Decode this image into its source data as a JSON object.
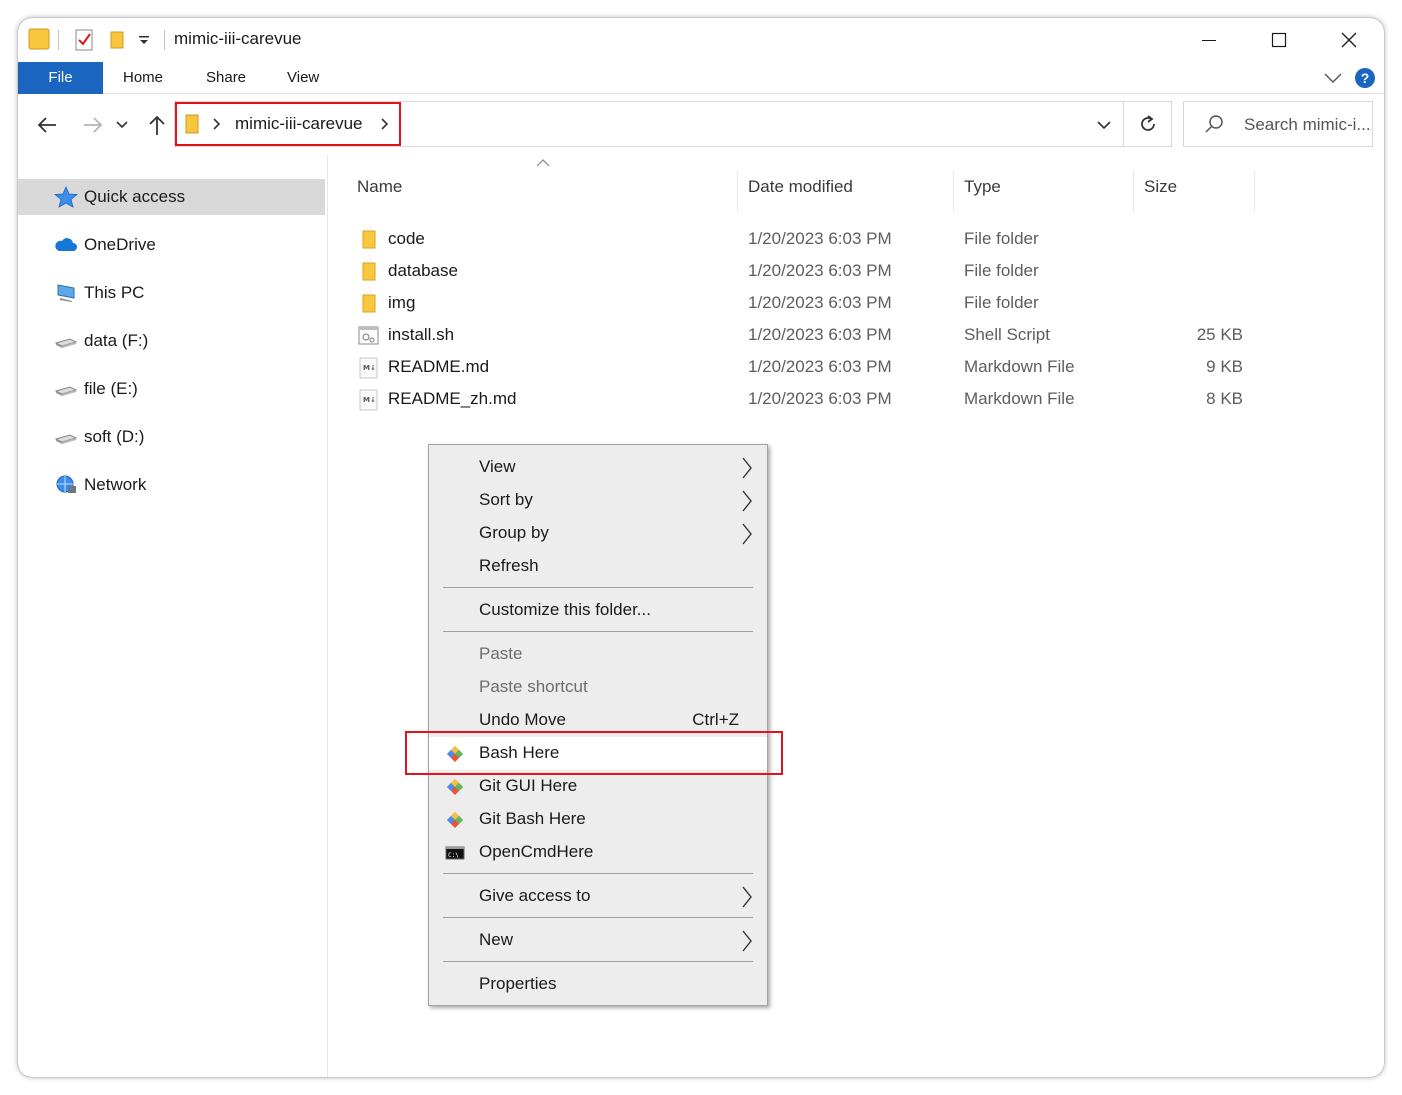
{
  "window": {
    "title": "mimic-iii-carevue"
  },
  "ribbon": {
    "tabs": [
      "File",
      "Home",
      "Share",
      "View"
    ]
  },
  "address": {
    "path": "mimic-iii-carevue"
  },
  "search": {
    "placeholder": "Search mimic-i..."
  },
  "sidebar": {
    "items": [
      {
        "label": "Quick access",
        "icon": "star-icon",
        "selected": true
      },
      {
        "label": "OneDrive",
        "icon": "cloud-icon"
      },
      {
        "label": "This PC",
        "icon": "computer-icon"
      },
      {
        "label": "data (F:)",
        "icon": "drive-icon"
      },
      {
        "label": "file (E:)",
        "icon": "drive-icon"
      },
      {
        "label": "soft (D:)",
        "icon": "drive-icon"
      },
      {
        "label": "Network",
        "icon": "network-icon"
      }
    ]
  },
  "columns": {
    "name": "Name",
    "date": "Date modified",
    "type": "Type",
    "size": "Size"
  },
  "files": [
    {
      "name": "code",
      "date": "1/20/2023 6:03 PM",
      "type": "File folder",
      "size": "",
      "icon": "folder-icon"
    },
    {
      "name": "database",
      "date": "1/20/2023 6:03 PM",
      "type": "File folder",
      "size": "",
      "icon": "folder-icon"
    },
    {
      "name": "img",
      "date": "1/20/2023 6:03 PM",
      "type": "File folder",
      "size": "",
      "icon": "folder-icon"
    },
    {
      "name": "install.sh",
      "date": "1/20/2023 6:03 PM",
      "type": "Shell Script",
      "size": "25 KB",
      "icon": "script-file-icon"
    },
    {
      "name": "README.md",
      "date": "1/20/2023 6:03 PM",
      "type": "Markdown File",
      "size": "9 KB",
      "icon": "markdown-file-icon"
    },
    {
      "name": "README_zh.md",
      "date": "1/20/2023 6:03 PM",
      "type": "Markdown File",
      "size": "8 KB",
      "icon": "markdown-file-icon"
    }
  ],
  "context_menu": {
    "view": "View",
    "sort_by": "Sort by",
    "group_by": "Group by",
    "refresh": "Refresh",
    "customize": "Customize this folder...",
    "paste": "Paste",
    "paste_shortcut": "Paste shortcut",
    "undo_move": "Undo Move",
    "undo_shortcut": "Ctrl+Z",
    "bash_here": "Bash Here",
    "git_gui_here": "Git GUI Here",
    "git_bash_here": "Git Bash Here",
    "open_cmd_here": "OpenCmdHere",
    "give_access": "Give access to",
    "new": "New",
    "properties": "Properties"
  },
  "colors": {
    "accent": "#1a65c0",
    "highlight": "#e0141b",
    "folder": "#f8c73e"
  }
}
